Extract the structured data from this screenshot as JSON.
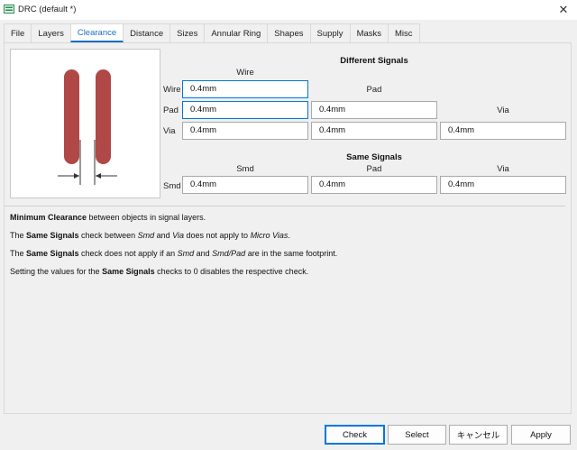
{
  "window": {
    "title": "DRC (default *)"
  },
  "tabs": [
    {
      "label": "File"
    },
    {
      "label": "Layers"
    },
    {
      "label": "Clearance"
    },
    {
      "label": "Distance"
    },
    {
      "label": "Sizes"
    },
    {
      "label": "Annular Ring"
    },
    {
      "label": "Shapes"
    },
    {
      "label": "Supply"
    },
    {
      "label": "Masks"
    },
    {
      "label": "Misc"
    }
  ],
  "different_signals": {
    "title": "Different Signals",
    "col_wire": "Wire",
    "col_pad": "Pad",
    "col_via": "Via",
    "row_wire": "Wire",
    "row_pad": "Pad",
    "row_via": "Via",
    "wire_wire": "0.4mm",
    "pad_wire": "0.4mm",
    "pad_pad": "0.4mm",
    "via_wire": "0.4mm",
    "via_pad": "0.4mm",
    "via_via": "0.4mm"
  },
  "same_signals": {
    "title": "Same Signals",
    "col_smd": "Smd",
    "col_pad": "Pad",
    "col_via": "Via",
    "row_smd": "Smd",
    "smd_smd": "0.4mm",
    "smd_pad": "0.4mm",
    "smd_via": "0.4mm"
  },
  "help": {
    "l1_b": "Minimum Clearance",
    "l1_t": " between objects in signal layers.",
    "l2_a": "The ",
    "l2_b": "Same Signals",
    "l2_c": " check between ",
    "l2_d": "Smd",
    "l2_e": " and ",
    "l2_f": "Via",
    "l2_g": " does not apply to ",
    "l2_h": "Micro Vias",
    "l2_i": ".",
    "l3_a": "The ",
    "l3_b": "Same Signals",
    "l3_c": " check does not apply if an ",
    "l3_d": "Smd",
    "l3_e": " and ",
    "l3_f": "Smd/Pad",
    "l3_g": " are in the same footprint.",
    "l4_a": "Setting the values for the ",
    "l4_b": "Same Signals",
    "l4_c": " checks to 0 disables the respective check."
  },
  "buttons": {
    "check": "Check",
    "select": "Select",
    "cancel": "キャンセル",
    "apply": "Apply"
  },
  "colors": {
    "accent": "#0078d7",
    "trace": "#b04848"
  }
}
